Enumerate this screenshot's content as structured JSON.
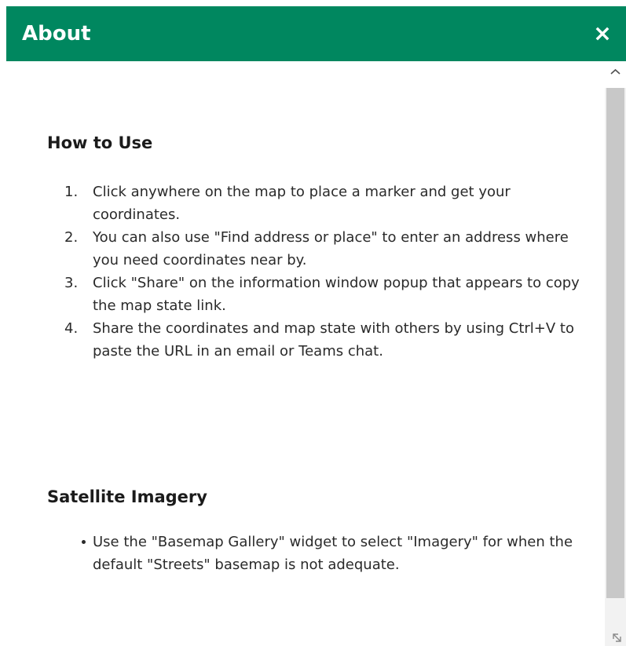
{
  "header": {
    "title": "About",
    "close_icon": "close-icon",
    "background_color": "#00875f"
  },
  "sections": {
    "how_to_use": {
      "heading": "How to Use",
      "steps": [
        {
          "num": "1.",
          "text": "Click anywhere on the map to place a marker and get your coordinates."
        },
        {
          "num": "2.",
          "text": "You can also use \"Find address or place\" to enter an address where you need coordinates near by."
        },
        {
          "num": "3.",
          "text": "Click \"Share\" on the information window popup that appears to copy the map state link."
        },
        {
          "num": "4.",
          "text": "Share the coordinates and map state with others by using Ctrl+V to paste the URL in an email or Teams chat."
        }
      ]
    },
    "satellite_imagery": {
      "heading": "Satellite Imagery",
      "bullets": [
        {
          "text": "Use the \"Basemap Gallery\" widget to select \"Imagery\" for when the default \"Streets\" basemap is not adequate."
        }
      ]
    }
  },
  "scrollbar": {
    "up_icon": "chevron-up-icon",
    "resize_icon": "resize-handle-icon"
  }
}
